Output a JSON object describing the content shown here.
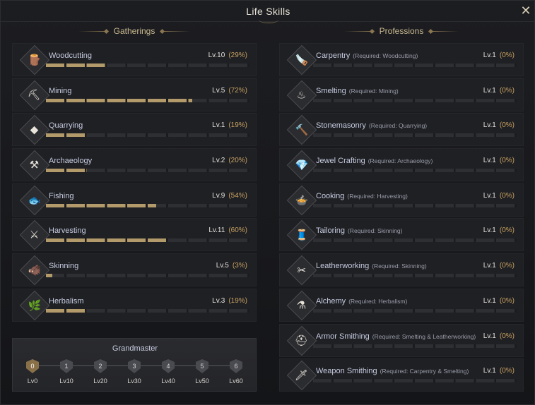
{
  "window": {
    "title": "Life Skills",
    "close_icon": "close-icon"
  },
  "gatherings": {
    "header": "Gatherings",
    "skills": [
      {
        "name": "Woodcutting",
        "level": "Lv.10",
        "percent": "(29%)",
        "progress": 0.29,
        "icon": "axe-log-icon",
        "glyph": "🪵"
      },
      {
        "name": "Mining",
        "level": "Lv.5",
        "percent": "(72%)",
        "progress": 0.72,
        "icon": "pickaxe-icon",
        "glyph": "⛏"
      },
      {
        "name": "Quarrying",
        "level": "Lv.1",
        "percent": "(19%)",
        "progress": 0.19,
        "icon": "rock-icon",
        "glyph": "◆"
      },
      {
        "name": "Archaeology",
        "level": "Lv.2",
        "percent": "(20%)",
        "progress": 0.2,
        "icon": "shovel-icon",
        "glyph": "⚒"
      },
      {
        "name": "Fishing",
        "level": "Lv.9",
        "percent": "(54%)",
        "progress": 0.54,
        "icon": "fish-icon",
        "glyph": "🐟"
      },
      {
        "name": "Harvesting",
        "level": "Lv.11",
        "percent": "(60%)",
        "progress": 0.6,
        "icon": "sickle-icon",
        "glyph": "⚔"
      },
      {
        "name": "Skinning",
        "level": "Lv.5",
        "percent": "(3%)",
        "progress": 0.03,
        "icon": "boar-icon",
        "glyph": "🐗"
      },
      {
        "name": "Herbalism",
        "level": "Lv.3",
        "percent": "(19%)",
        "progress": 0.19,
        "icon": "herb-icon",
        "glyph": "🌿"
      }
    ]
  },
  "professions": {
    "header": "Professions",
    "skills": [
      {
        "name": "Carpentry",
        "required": "(Required: Woodcutting)",
        "level": "Lv.1",
        "percent": "(0%)",
        "progress": 0,
        "icon": "saw-icon",
        "glyph": "🪚"
      },
      {
        "name": "Smelting",
        "required": "(Required: Mining)",
        "level": "Lv.1",
        "percent": "(0%)",
        "progress": 0,
        "icon": "furnace-icon",
        "glyph": "♨"
      },
      {
        "name": "Stonemasonry",
        "required": "(Required: Quarrying)",
        "level": "Lv.1",
        "percent": "(0%)",
        "progress": 0,
        "icon": "hammer-icon",
        "glyph": "🔨"
      },
      {
        "name": "Jewel Crafting",
        "required": "(Required: Archaeology)",
        "level": "Lv.1",
        "percent": "(0%)",
        "progress": 0,
        "icon": "gem-icon",
        "glyph": "💎"
      },
      {
        "name": "Cooking",
        "required": "(Required: Harvesting)",
        "level": "Lv.1",
        "percent": "(0%)",
        "progress": 0,
        "icon": "pot-icon",
        "glyph": "🍲"
      },
      {
        "name": "Tailoring",
        "required": "(Required: Skinning)",
        "level": "Lv.1",
        "percent": "(0%)",
        "progress": 0,
        "icon": "needle-icon",
        "glyph": "🧵"
      },
      {
        "name": "Leatherworking",
        "required": "(Required: Skinning)",
        "level": "Lv.1",
        "percent": "(0%)",
        "progress": 0,
        "icon": "leather-icon",
        "glyph": "✂"
      },
      {
        "name": "Alchemy",
        "required": "(Required: Herbalism)",
        "level": "Lv.1",
        "percent": "(0%)",
        "progress": 0,
        "icon": "flask-icon",
        "glyph": "⚗"
      },
      {
        "name": "Armor Smithing",
        "required": "(Required: Smelting & Leatherworking)",
        "level": "Lv.1",
        "percent": "(0%)",
        "progress": 0,
        "icon": "helmet-icon",
        "glyph": "⛑"
      },
      {
        "name": "Weapon Smithing",
        "required": "(Required: Carpentry & Smelting)",
        "level": "Lv.1",
        "percent": "(0%)",
        "progress": 0,
        "icon": "sword-icon",
        "glyph": "🗡"
      }
    ]
  },
  "grandmaster": {
    "title": "Grandmaster",
    "tiers": [
      {
        "number": "0",
        "label": "Lv0",
        "active": true
      },
      {
        "number": "1",
        "label": "Lv10",
        "active": false
      },
      {
        "number": "2",
        "label": "Lv20",
        "active": false
      },
      {
        "number": "3",
        "label": "Lv30",
        "active": false
      },
      {
        "number": "4",
        "label": "Lv40",
        "active": false
      },
      {
        "number": "5",
        "label": "Lv50",
        "active": false
      },
      {
        "number": "6",
        "label": "Lv60",
        "active": false
      }
    ]
  }
}
